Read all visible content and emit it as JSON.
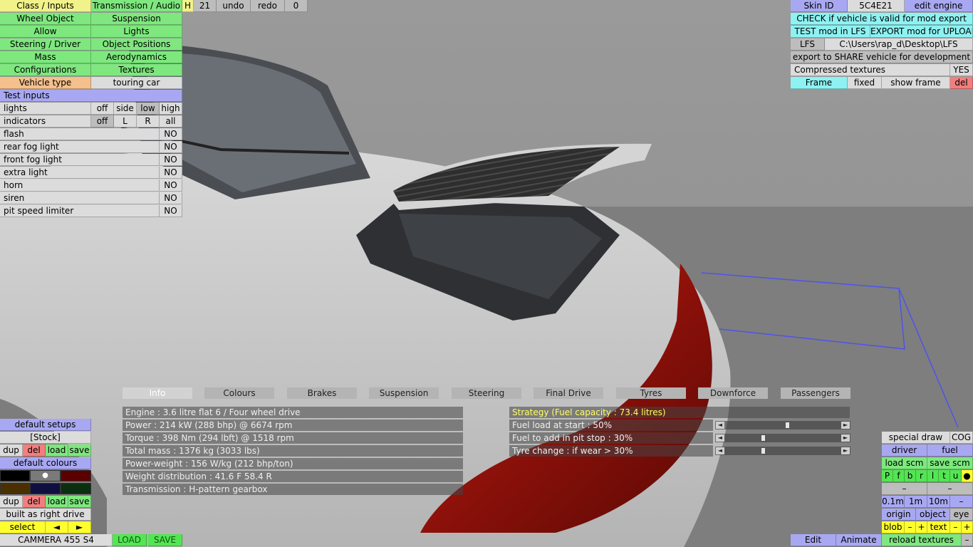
{
  "top_left_menu": {
    "class_inputs": "Class / Inputs",
    "transmission_audio": "Transmission / Audio",
    "h": "H",
    "num": "21",
    "undo": "undo",
    "redo": "redo",
    "zero": "0",
    "wheel_object": "Wheel Object",
    "suspension": "Suspension",
    "allow": "Allow",
    "lights": "Lights",
    "steering_driver": "Steering / Driver",
    "object_positions": "Object Positions",
    "mass": "Mass",
    "aerodynamics": "Aerodynamics",
    "configurations": "Configurations",
    "textures": "Textures",
    "vehicle_type": "Vehicle type",
    "vehicle_type_value": "touring car"
  },
  "test_inputs": {
    "header": "Test inputs",
    "lights_label": "lights",
    "lights_options": [
      "off",
      "side",
      "low",
      "high"
    ],
    "indicators_label": "indicators",
    "indicator_options": [
      "off",
      "L",
      "R",
      "all"
    ],
    "rows": [
      {
        "label": "flash",
        "value": "NO"
      },
      {
        "label": "rear fog light",
        "value": "NO"
      },
      {
        "label": "front fog light",
        "value": "NO"
      },
      {
        "label": "extra light",
        "value": "NO"
      },
      {
        "label": "horn",
        "value": "NO"
      },
      {
        "label": "siren",
        "value": "NO"
      },
      {
        "label": "pit speed limiter",
        "value": "NO"
      }
    ]
  },
  "top_right": {
    "skin_id_label": "Skin ID",
    "skin_id_value": "5C4E21",
    "edit_engine": "edit engine",
    "check_valid": "CHECK if vehicle is valid for mod export",
    "test_mod": "TEST mod in LFS",
    "export_mod": "EXPORT mod for UPLOAD",
    "lfs": "LFS",
    "lfs_path": "C:\\Users\\rap_d\\Desktop\\LFS",
    "export_share": "export to SHARE vehicle for development",
    "compressed_textures": "Compressed textures",
    "compressed_value": "YES",
    "frame": "Frame",
    "fixed": "fixed",
    "show_frame": "show frame",
    "del": "del"
  },
  "info_panel": {
    "tabs": [
      "Info",
      "Colours",
      "Brakes",
      "Suspension",
      "Steering",
      "Final Drive",
      "Tyres",
      "Downforce",
      "Passengers"
    ],
    "lines": [
      "Engine : 3.6 litre flat 6 / Four wheel drive",
      "Power : 214 kW (288 bhp) @ 6674 rpm",
      "Torque : 398 Nm (294 lbft) @ 1518 rpm",
      "Total mass : 1376 kg (3033 lbs)",
      "Power-weight : 156 W/kg (212 bhp/ton)",
      "Weight distribution : 41.6 F  58.4 R",
      "Transmission : H-pattern gearbox"
    ],
    "strategy": "Strategy (Fuel capacity : 73.4 litres)",
    "fuel_load": "Fuel load at start : 50%",
    "fuel_add": "Fuel to add in pit stop : 30%",
    "tyre_change": "Tyre change : if wear > 30%",
    "fuel_load_level": 0.5,
    "fuel_add_level": 0.3,
    "tyre_change_level": 0.3
  },
  "bottom_left": {
    "default_setups": "default setups",
    "stock": "[Stock]",
    "dup": "dup",
    "del": "del",
    "load": "load",
    "save": "save",
    "default_colours": "default colours",
    "dup2": "dup",
    "del2": "del",
    "load2": "load",
    "save2": "save",
    "built_as": "built as right drive",
    "select": "select",
    "prev": "◄",
    "next": "►",
    "car_name": "CAMMERA 455 S4",
    "load_btn": "LOAD",
    "save_btn": "SAVE",
    "colours": {
      "swatch1": "#000000",
      "swatch2": "#7a7a7a",
      "swatch3": "#5a0000",
      "swatch4": "#4a3000",
      "swatch5": "#101040",
      "swatch6": "#0a3010"
    }
  },
  "bottom_right": {
    "special_draw": "special draw",
    "cog": "COG",
    "driver": "driver",
    "fuel": "fuel",
    "load_scm": "load scm",
    "save_scm": "save scm",
    "letters": [
      "P",
      "f",
      "b",
      "r",
      "l",
      "t",
      "u",
      "●"
    ],
    "minus1": "–",
    "minus2": "–",
    "scale_01": "0.1m",
    "scale_1": "1m",
    "scale_10": "10m",
    "scale_minus": "–",
    "origin": "origin",
    "object": "object",
    "eye": "eye",
    "blob": "blob",
    "blob_minus": "–",
    "blob_plus": "+",
    "text": "text",
    "text_minus": "–",
    "text_plus": "+",
    "edit": "Edit",
    "animate": "Animate",
    "reload_textures": "reload textures",
    "tiny_minus": "–"
  }
}
